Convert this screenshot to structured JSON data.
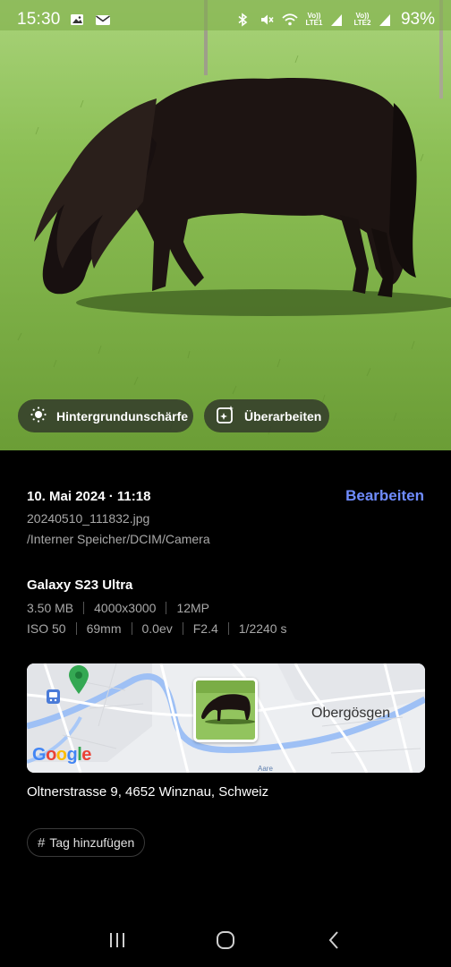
{
  "status_bar": {
    "time": "15:30",
    "left_icons": [
      "image-icon",
      "mail-icon"
    ],
    "right_icons": [
      "bluetooth-icon",
      "mute-icon",
      "wifi-icon",
      "signal-icon",
      "signal-icon"
    ],
    "sim1": "Vo)) LTE1",
    "sim2": "Vo)) LTE2",
    "battery": "93%"
  },
  "photo": {
    "subject": "pony-photo"
  },
  "chips": {
    "background_blur": "Hintergrundunschärfe",
    "rework": "Überarbeiten"
  },
  "details": {
    "date": "10. Mai 2024 · 11:18",
    "edit_label": "Bearbeiten",
    "filename": "20240510_111832.jpg",
    "path": "/Interner Speicher/DCIM/Camera",
    "device": "Galaxy S23 Ultra",
    "file_info": [
      "3.50 MB",
      "4000x3000",
      "12MP"
    ],
    "camera_info": [
      "ISO 50",
      "69mm",
      "0.0ev",
      "F2.4",
      "1/2240 s"
    ]
  },
  "map": {
    "place_label": "Obergösgen",
    "provider": "Google",
    "road_label": "Aare"
  },
  "address": "Oltnerstrasse 9, 4652 Winznau, Schweiz",
  "tag_button": "Tag hinzufügen",
  "nav": {
    "icons": [
      "recent-apps-icon",
      "home-icon",
      "back-icon"
    ]
  },
  "colors": {
    "accent": "#6f8cff",
    "background": "#000000",
    "secondary_text": "#a8a8a8"
  }
}
